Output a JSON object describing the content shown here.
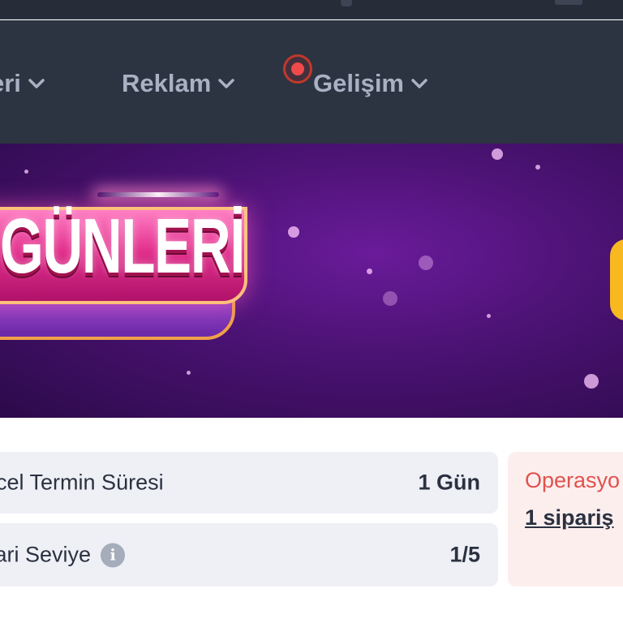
{
  "nav": {
    "items": [
      {
        "label": "eri",
        "icon": "chevron-down-icon"
      },
      {
        "label": "Reklam",
        "icon": "chevron-down-icon"
      },
      {
        "label": "Gelişim",
        "icon": "chevron-down-icon"
      }
    ],
    "notification_icon": "notification-dot-icon"
  },
  "banner": {
    "title": "GÜNLERİ"
  },
  "stats": {
    "delivery": {
      "label": "ncel Termin Süresi",
      "value": "1 Gün"
    },
    "level": {
      "label": "cari Seviye",
      "value": "1/5",
      "info_icon": "i"
    }
  },
  "alert": {
    "title": "Operasyo",
    "link": "1 sipariş"
  },
  "colors": {
    "nav_bg": "#2c3341",
    "nav_text": "#a9b1c2",
    "card_bg": "#eef0f6",
    "alert_bg": "#fdeeee",
    "alert_title": "#e0534d",
    "notification": "#f04b4b",
    "banner_purple": "#4a1272"
  }
}
